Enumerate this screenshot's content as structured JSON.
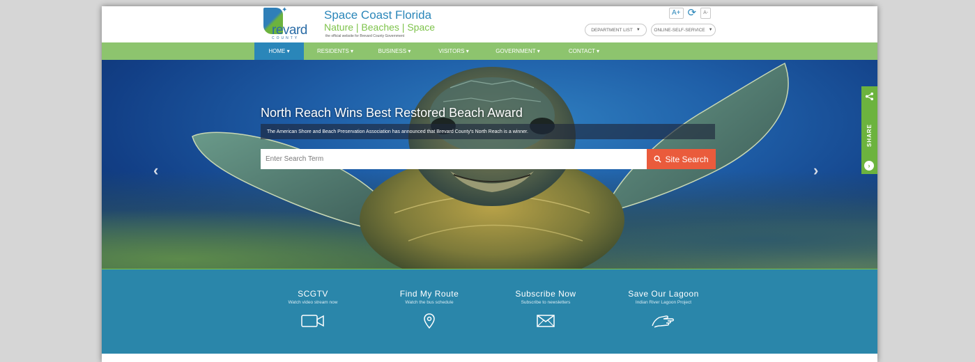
{
  "header": {
    "logo_word": "revard",
    "logo_sub": "COUNTY",
    "tagline_title": "Space Coast Florida",
    "tagline_sub": "Nature | Beaches | Space",
    "tagline_small": "the official website for Brevard County Government",
    "font_increase": "A+",
    "font_decrease": "A-",
    "department_list": "DEPARTMENT LIST",
    "online_self_service": "ONLINE-SELF-SERVICE"
  },
  "nav": {
    "items": [
      {
        "label": "HOME ▾"
      },
      {
        "label": "RESIDENTS ▾"
      },
      {
        "label": "BUSINESS ▾"
      },
      {
        "label": "VISITORS ▾"
      },
      {
        "label": "GOVERNMENT ▾"
      },
      {
        "label": "CONTACT ▾"
      }
    ]
  },
  "hero": {
    "title": "North Reach Wins Best Restored Beach Award",
    "description": "The American Shore and Beach Preservation Association has announced that Brevard County's North Reach is a winner.",
    "search_placeholder": "Enter Search Term",
    "search_button": "Site Search",
    "prev_arrow": "‹",
    "next_arrow": "›"
  },
  "share": {
    "label": "SHARE"
  },
  "features": [
    {
      "title": "SCGTV",
      "subtitle": "Watch video stream now",
      "icon": "video-camera-icon"
    },
    {
      "title": "Find My Route",
      "subtitle": "Watch the bus schedule",
      "icon": "map-pin-icon"
    },
    {
      "title": "Subscribe Now",
      "subtitle": "Subscribe to newsletters",
      "icon": "envelope-icon"
    },
    {
      "title": "Save Our Lagoon",
      "subtitle": "Indian River Lagoon Project",
      "icon": "hand-icon"
    }
  ],
  "colors": {
    "nav_green": "#8dc46e",
    "active_blue": "#2a86b9",
    "search_orange": "#ea5b3c",
    "features_blue": "#2a86aa",
    "share_green": "#6cb33e"
  }
}
